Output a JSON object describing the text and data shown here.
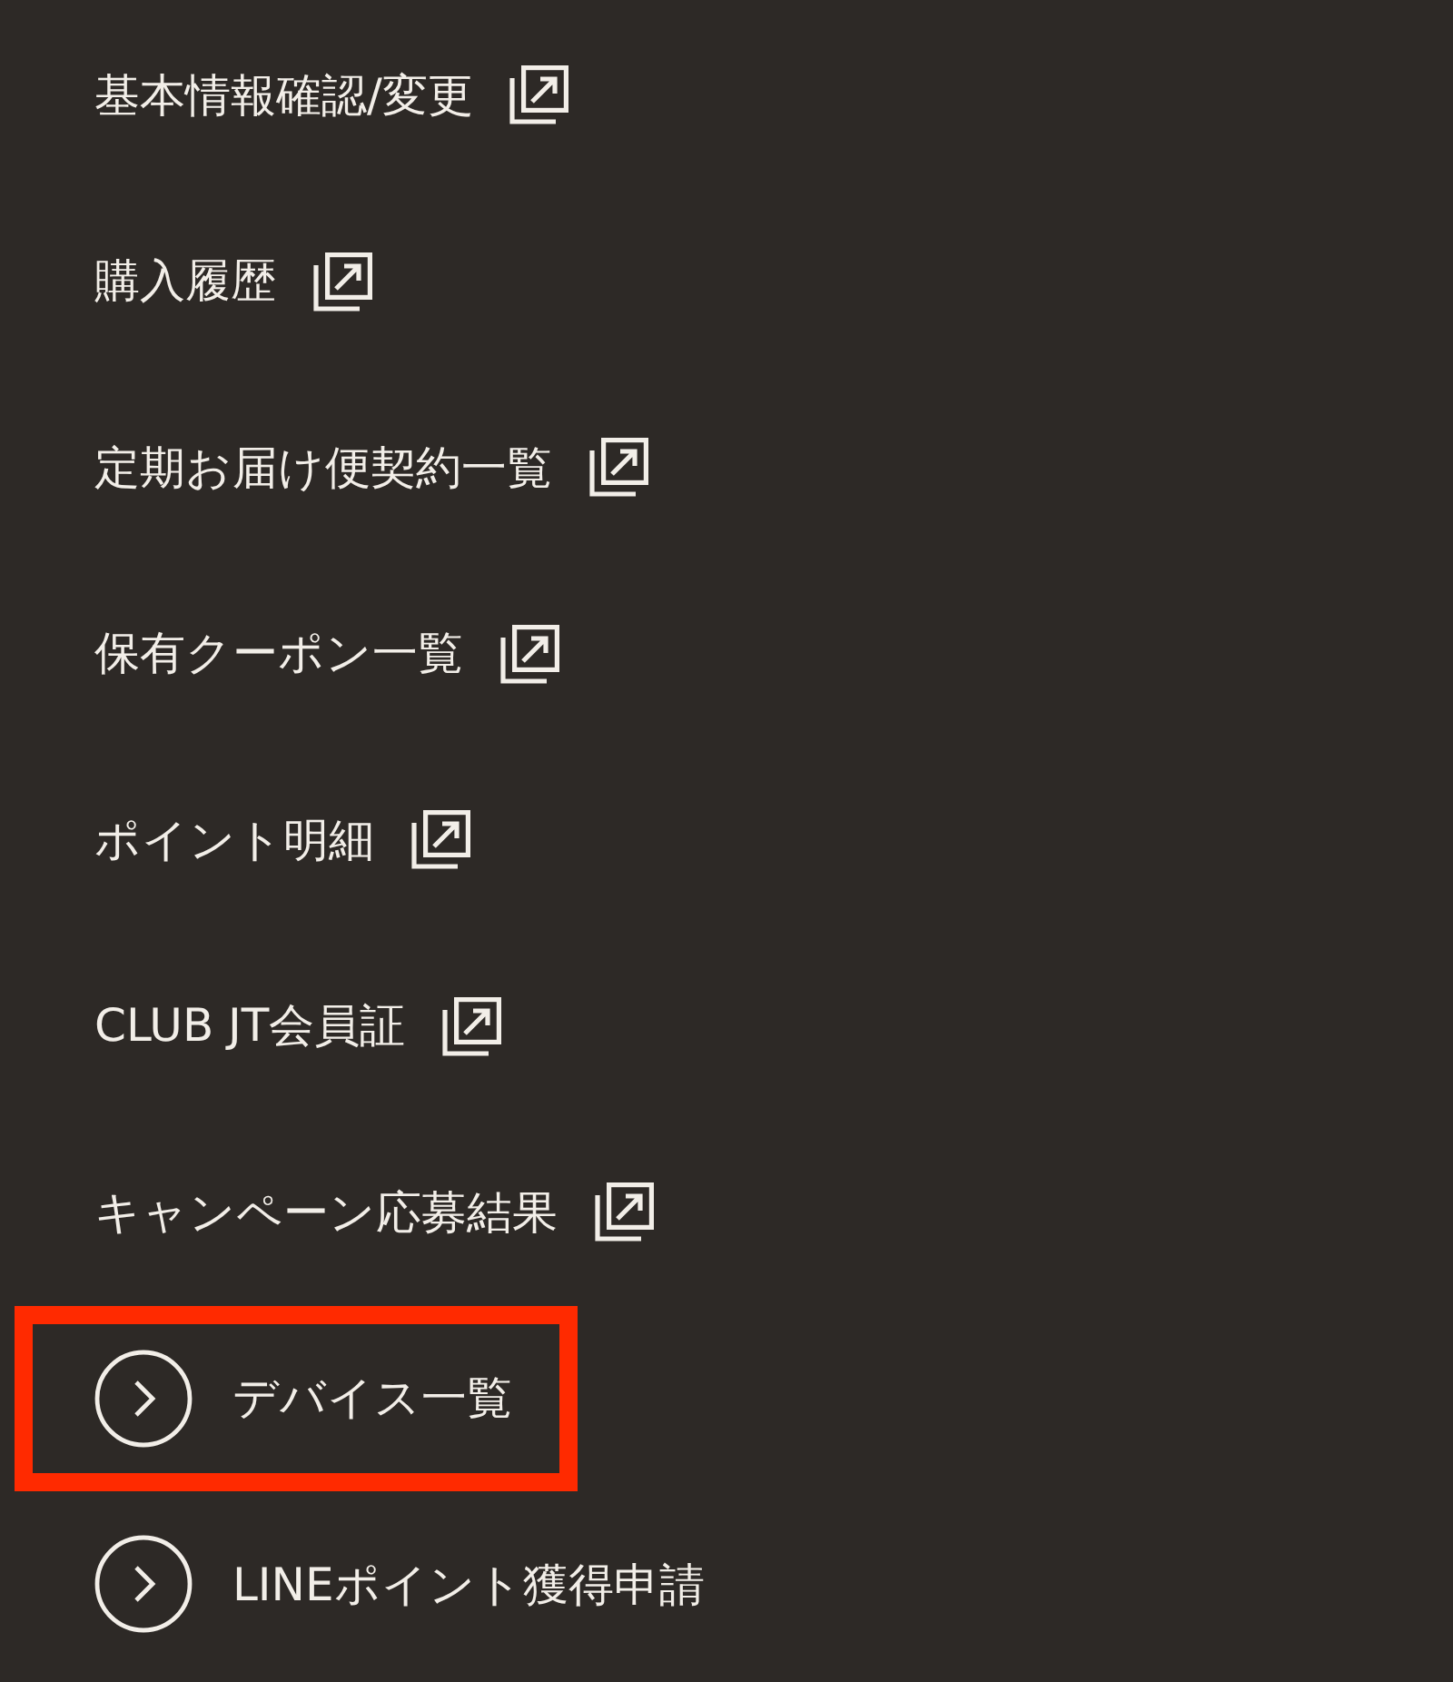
{
  "menu": {
    "items": [
      {
        "label": "基本情報確認/変更",
        "kind": "external",
        "highlighted": false
      },
      {
        "label": "購入履歴",
        "kind": "external",
        "highlighted": false
      },
      {
        "label": "定期お届け便契約一覧",
        "kind": "external",
        "highlighted": false
      },
      {
        "label": "保有クーポン一覧",
        "kind": "external",
        "highlighted": false
      },
      {
        "label": "ポイント明細",
        "kind": "external",
        "highlighted": false
      },
      {
        "label": "CLUB JT会員証",
        "kind": "external",
        "highlighted": false
      },
      {
        "label": "キャンペーン応募結果",
        "kind": "external",
        "highlighted": false
      },
      {
        "label": "デバイス一覧",
        "kind": "arrow",
        "highlighted": true
      },
      {
        "label": "LINEポイント獲得申請",
        "kind": "arrow",
        "highlighted": false
      }
    ]
  }
}
